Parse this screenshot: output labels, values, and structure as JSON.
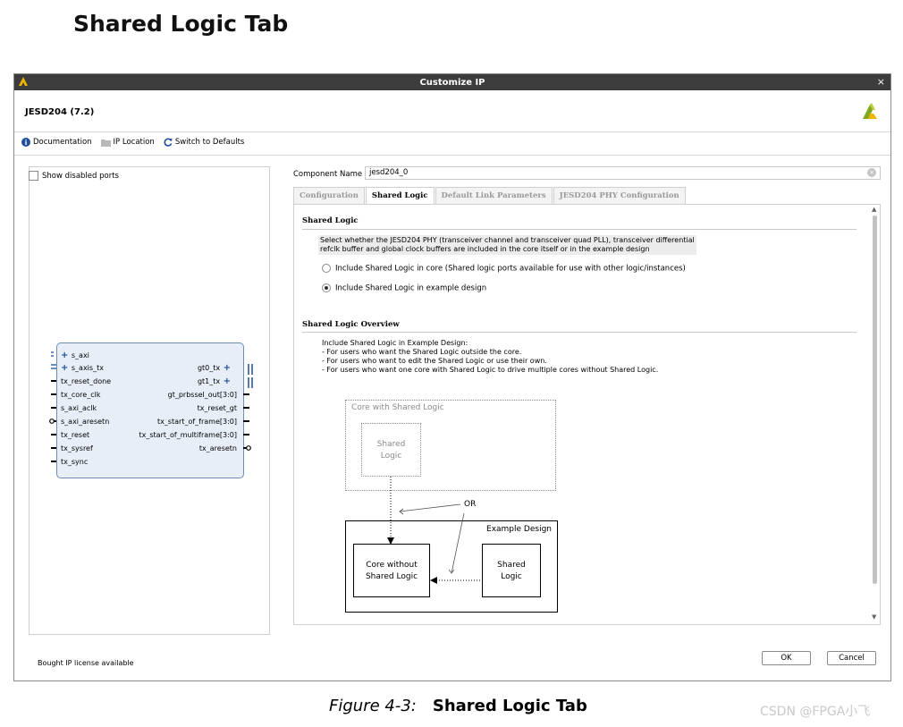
{
  "page": {
    "heading": "Shared Logic Tab",
    "figure_label": "Figure 4-3:",
    "figure_caption": "Shared Logic Tab",
    "watermark": "CSDN @FPGA小飞"
  },
  "window": {
    "title": "Customize IP",
    "close": "×",
    "ip_name": "JESD204 (7.2)"
  },
  "toolbar": {
    "documentation": "Documentation",
    "ip_location": "IP Location",
    "switch_defaults": "Switch to Defaults"
  },
  "left_panel": {
    "show_disabled_ports": "Show disabled ports",
    "ports_left": [
      "s_axi",
      "s_axis_tx",
      "tx_reset_done",
      "tx_core_clk",
      "s_axi_aclk",
      "s_axi_aresetn",
      "tx_reset",
      "tx_sysref",
      "tx_sync"
    ],
    "ports_right": [
      "gt0_tx",
      "gt1_tx",
      "gt_prbssel_out[3:0]",
      "tx_reset_gt",
      "tx_start_of_frame[3:0]",
      "tx_start_of_multiframe[3:0]",
      "tx_aresetn"
    ],
    "license": "Bought IP license available"
  },
  "component": {
    "label": "Component Name",
    "value": "jesd204_0"
  },
  "tabs": [
    "Configuration",
    "Shared Logic",
    "Default Link Parameters",
    "JESD204 PHY Configuration"
  ],
  "shared_logic": {
    "title": "Shared Logic",
    "desc1": "Select whether the JESD204 PHY (transceiver channel and transceiver quad PLL), transceiver differential",
    "desc2": "refclk buffer and global clock buffers are included in the core itself or in the example design",
    "option1": "Include Shared Logic in core (Shared logic ports available for use with other logic/instances)",
    "option2": "Include Shared Logic in example design",
    "selected": 2
  },
  "overview": {
    "title": "Shared Logic Overview",
    "lines": [
      "Include Shared Logic in Example Design:",
      "- For users who want the Shared Logic outside the core.",
      "- For users who want to edit the Shared Logic or use their own.",
      "- For users who want one core with Shared Logic to drive multiple cores without Shared Logic."
    ]
  },
  "diagram": {
    "core_with": "Core with Shared Logic",
    "shared1": "Shared",
    "logic1": "Logic",
    "or": "OR",
    "example_design": "Example Design",
    "core_without1": "Core without",
    "core_without2": "Shared Logic",
    "shared2": "Shared",
    "logic2": "Logic"
  },
  "buttons": {
    "ok": "OK",
    "cancel": "Cancel"
  }
}
